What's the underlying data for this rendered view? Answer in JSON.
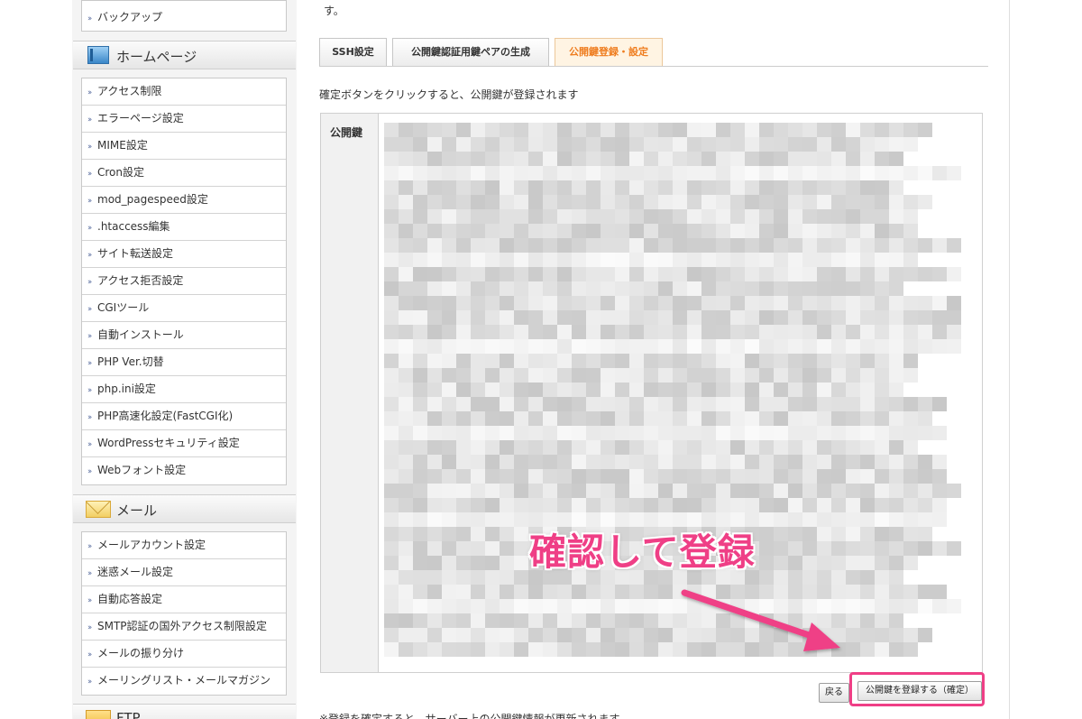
{
  "sidebar": {
    "top_items": [
      {
        "label": "バックアップ"
      }
    ],
    "sections": [
      {
        "title": "ホームページ",
        "icon": "homepage-icon",
        "items": [
          {
            "label": "アクセス制限"
          },
          {
            "label": "エラーページ設定"
          },
          {
            "label": "MIME設定"
          },
          {
            "label": "Cron設定"
          },
          {
            "label": "mod_pagespeed設定"
          },
          {
            "label": ".htaccess編集"
          },
          {
            "label": "サイト転送設定"
          },
          {
            "label": "アクセス拒否設定"
          },
          {
            "label": "CGIツール"
          },
          {
            "label": "自動インストール"
          },
          {
            "label": "PHP Ver.切替"
          },
          {
            "label": "php.ini設定"
          },
          {
            "label": "PHP高速化設定(FastCGI化)"
          },
          {
            "label": "WordPressセキュリティ設定"
          },
          {
            "label": "Webフォント設定"
          }
        ]
      },
      {
        "title": "メール",
        "icon": "mail-icon",
        "items": [
          {
            "label": "メールアカウント設定"
          },
          {
            "label": "迷惑メール設定"
          },
          {
            "label": "自動応答設定"
          },
          {
            "label": "SMTP認証の国外アクセス制限設定"
          },
          {
            "label": "メールの振り分け"
          },
          {
            "label": "メーリングリスト・メールマガジン"
          }
        ]
      },
      {
        "title": "FTP",
        "icon": "ftp-folder-icon",
        "items": []
      }
    ]
  },
  "main": {
    "top_text": "す。",
    "tabs": [
      {
        "label": "SSH設定",
        "active": false
      },
      {
        "label": "公開鍵認証用鍵ペアの生成",
        "active": false
      },
      {
        "label": "公開鍵登録・設定",
        "active": true
      }
    ],
    "instruction": "確定ボタンをクリックすると、公開鍵が登録されます",
    "public_key_label": "公開鍵",
    "annotation": "確認して登録",
    "back_button": "戻る",
    "confirm_button": "公開鍵を登録する（確定）",
    "bottom_note": "※登録を確定すると、サーバー上の公開鍵情報が更新されます"
  },
  "colors": {
    "accent_pink": "#ef3f86",
    "active_tab_text": "#ef7d1f",
    "active_tab_bg": "#fff4e3"
  }
}
